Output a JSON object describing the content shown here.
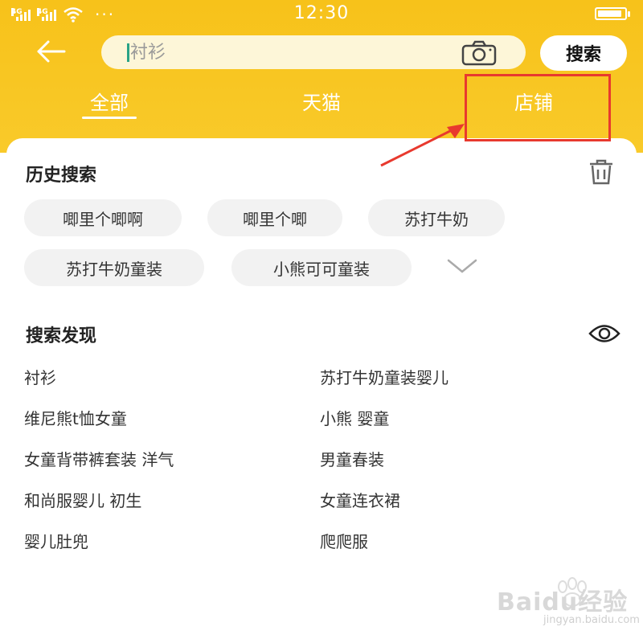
{
  "status_bar": {
    "time": "12:30",
    "signal_1": "4G",
    "signal_2": "4G",
    "more": "···",
    "battery_level": 0.9
  },
  "search": {
    "placeholder": "衬衫",
    "button_label": "搜索"
  },
  "tabs": [
    {
      "label": "全部",
      "active": true
    },
    {
      "label": "天猫",
      "active": false
    },
    {
      "label": "店铺",
      "active": false
    }
  ],
  "history": {
    "title": "历史搜索",
    "items": [
      "唧里个唧啊",
      "唧里个唧",
      "苏打牛奶",
      "苏打牛奶童装",
      "小熊可可童装"
    ]
  },
  "discovery": {
    "title": "搜索发现",
    "items": [
      "衬衫",
      "苏打牛奶童装婴儿",
      "维尼熊t恤女童",
      "小熊 婴童",
      "女童背带裤套装 洋气",
      "男童春装",
      "和尚服婴儿 初生",
      "女童连衣裙",
      "婴儿肚兜",
      "爬爬服"
    ]
  },
  "watermark": {
    "brand": "Baidu经验",
    "url": "jingyan.baidu.com"
  },
  "colors": {
    "header": "#f7c21a",
    "highlight": "#e8392e",
    "chip_bg": "#f2f2f2"
  },
  "icons": [
    "back-arrow-icon",
    "camera-icon",
    "trash-icon",
    "chevron-down-icon",
    "eye-icon"
  ]
}
